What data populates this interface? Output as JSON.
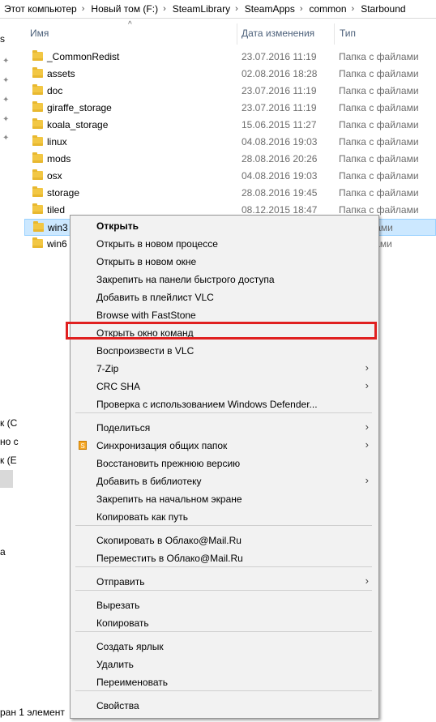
{
  "breadcrumb": [
    "Этот компьютер",
    "Новый том (F:)",
    "SteamLibrary",
    "SteamApps",
    "common",
    "Starbound"
  ],
  "nav": {
    "fragments": [
      "s",
      "к (C",
      "но c",
      "к (E",
      "а"
    ]
  },
  "columns": {
    "name": "Имя",
    "date": "Дата изменения",
    "type": "Тип"
  },
  "files": [
    {
      "name": "_CommonRedist",
      "date": "23.07.2016 11:19",
      "type": "Папка с файлами"
    },
    {
      "name": "assets",
      "date": "02.08.2016 18:28",
      "type": "Папка с файлами"
    },
    {
      "name": "doc",
      "date": "23.07.2016 11:19",
      "type": "Папка с файлами"
    },
    {
      "name": "giraffe_storage",
      "date": "23.07.2016 11:19",
      "type": "Папка с файлами"
    },
    {
      "name": "koala_storage",
      "date": "15.06.2015 11:27",
      "type": "Папка с файлами"
    },
    {
      "name": "linux",
      "date": "04.08.2016 19:03",
      "type": "Папка с файлами"
    },
    {
      "name": "mods",
      "date": "28.08.2016 20:26",
      "type": "Папка с файлами"
    },
    {
      "name": "osx",
      "date": "04.08.2016 19:03",
      "type": "Папка с файлами"
    },
    {
      "name": "storage",
      "date": "28.08.2016 19:45",
      "type": "Папка с файлами"
    },
    {
      "name": "tiled",
      "date": "08.12.2015 18:47",
      "type": "Папка с файлами"
    },
    {
      "name": "win3",
      "date": "",
      "type": "файлами"
    },
    {
      "name": "win6",
      "date": "",
      "type": "файлами"
    }
  ],
  "status": {
    "text": "ран 1 элемент"
  },
  "menu": {
    "items": [
      {
        "label": "Открыть",
        "bold": true
      },
      {
        "label": "Открыть в новом процессе"
      },
      {
        "label": "Открыть в новом окне"
      },
      {
        "label": "Закрепить на панели быстрого доступа"
      },
      {
        "label": "Добавить в плейлист VLC"
      },
      {
        "label": "Browse with FastStone"
      },
      {
        "label": "Открыть окно команд",
        "highlighted": true
      },
      {
        "label": "Воспроизвести в VLC"
      },
      {
        "label": "7-Zip",
        "submenu": true
      },
      {
        "label": "CRC SHA",
        "submenu": true
      },
      {
        "label": "Проверка с использованием Windows Defender..."
      },
      {
        "label": "Поделиться",
        "submenu": true
      },
      {
        "label": "Синхронизация общих папок",
        "submenu": true,
        "icon": "sync-folder-icon"
      },
      {
        "label": "Восстановить прежнюю версию"
      },
      {
        "label": "Добавить в библиотеку",
        "submenu": true
      },
      {
        "label": "Закрепить на начальном экране"
      },
      {
        "label": "Копировать как путь"
      },
      {
        "label": "Скопировать в Облако@Mail.Ru"
      },
      {
        "label": "Переместить в Облако@Mail.Ru"
      },
      {
        "label": "Отправить",
        "submenu": true
      },
      {
        "label": "Вырезать"
      },
      {
        "label": "Копировать"
      },
      {
        "label": "Создать ярлык"
      },
      {
        "label": "Удалить"
      },
      {
        "label": "Переименовать"
      },
      {
        "label": "Свойства"
      }
    ]
  }
}
